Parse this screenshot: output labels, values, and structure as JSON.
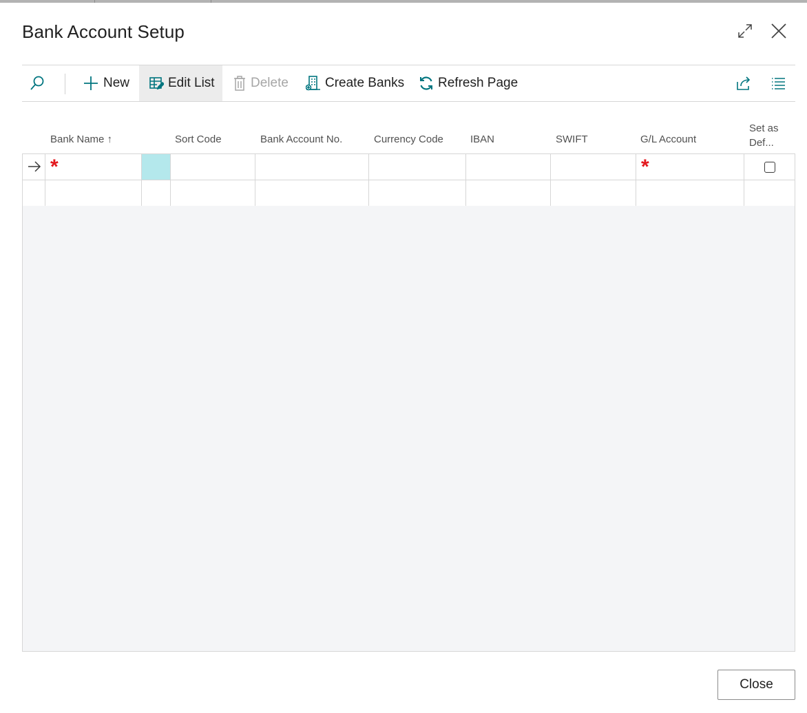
{
  "dialog": {
    "title": "Bank Account Setup"
  },
  "toolbar": {
    "new_label": "New",
    "edit_list_label": "Edit List",
    "delete_label": "Delete",
    "create_banks_label": "Create Banks",
    "refresh_label": "Refresh Page"
  },
  "grid": {
    "columns": [
      {
        "label": "Bank Name ↑"
      },
      {
        "label": "Sort Code"
      },
      {
        "label": "Bank Account No."
      },
      {
        "label": "Currency Code"
      },
      {
        "label": "IBAN"
      },
      {
        "label": "SWIFT"
      },
      {
        "label": "G/L Account"
      },
      {
        "label": "Set as",
        "label2": "Def..."
      }
    ],
    "rows": [
      {
        "bank_name": "",
        "sort_code": "",
        "bank_account_no": "",
        "currency_code": "",
        "iban": "",
        "swift": "",
        "gl_account": "",
        "set_as_default": false
      },
      {
        "bank_name": "",
        "sort_code": "",
        "bank_account_no": "",
        "currency_code": "",
        "iban": "",
        "swift": "",
        "gl_account": "",
        "set_as_default": false
      }
    ]
  },
  "footer": {
    "close_label": "Close"
  },
  "colors": {
    "accent": "#00757f",
    "required": "#e3191f",
    "focus_cell": "#b4e8ec"
  },
  "icons": [
    "search-icon",
    "plus-icon",
    "edit-list-icon",
    "delete-icon",
    "create-banks-icon",
    "refresh-icon",
    "share-icon",
    "list-view-icon",
    "expand-icon",
    "close-icon",
    "arrow-right-icon"
  ]
}
